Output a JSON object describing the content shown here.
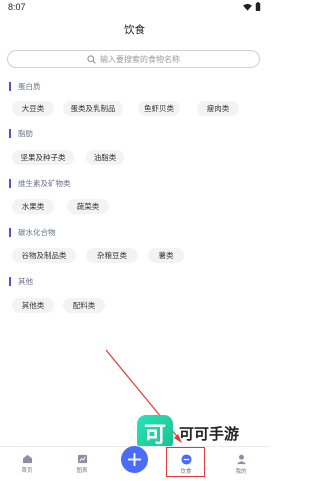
{
  "status": {
    "time": "8:07"
  },
  "page_title": "饮食",
  "search": {
    "placeholder": "输入要搜索的食物名称"
  },
  "sections": [
    {
      "title": "蛋白质",
      "chips": [
        "大豆类",
        "蛋类及乳制品",
        "鱼虾贝类",
        "瘦肉类"
      ]
    },
    {
      "title": "脂肪",
      "chips": [
        "坚果及种子类",
        "油脂类"
      ]
    },
    {
      "title": "维生素及矿物类",
      "chips": [
        "水果类",
        "蔬菜类"
      ]
    },
    {
      "title": "碳水化合物",
      "chips": [
        "谷物及制品类",
        "杂粮豆类",
        "薯类"
      ]
    },
    {
      "title": "其他",
      "chips": [
        "其他类",
        "配料类"
      ]
    }
  ],
  "tabbar": {
    "items": [
      {
        "label": "首页",
        "icon": "home-icon"
      },
      {
        "label": "图表",
        "icon": "chart-icon"
      },
      {
        "label": "饮食",
        "icon": "diet-icon"
      },
      {
        "label": "我的",
        "icon": "profile-icon"
      }
    ]
  },
  "watermark": {
    "badge": "可",
    "text": "可可手游"
  },
  "colors": {
    "accent": "#5b4fc7",
    "fab": "#4a6cf7",
    "chip_bg": "#f3f3f6",
    "highlight": "#e53935"
  }
}
